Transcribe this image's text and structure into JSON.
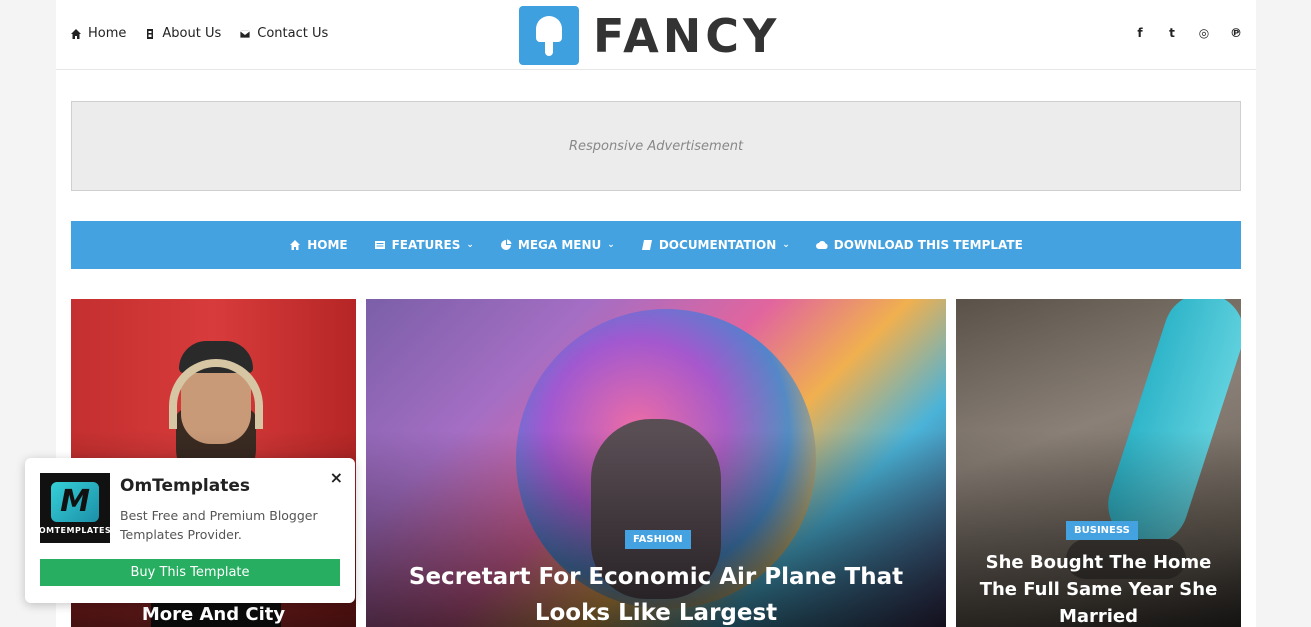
{
  "top_nav": {
    "items": [
      {
        "label": "Home",
        "icon": "home-icon"
      },
      {
        "label": "About Us",
        "icon": "id-card-icon"
      },
      {
        "label": "Contact Us",
        "icon": "envelope-icon"
      }
    ]
  },
  "logo": {
    "text": "FANCY",
    "accent": "#3fa0e0"
  },
  "social": [
    {
      "icon": "facebook-icon",
      "glyph": "f"
    },
    {
      "icon": "twitter-icon",
      "glyph": "t"
    },
    {
      "icon": "instagram-icon",
      "glyph": "◎"
    },
    {
      "icon": "pinterest-icon",
      "glyph": "℗"
    }
  ],
  "ad": {
    "text": "Responsive Advertisement"
  },
  "main_nav": {
    "items": [
      {
        "label": "HOME",
        "icon": "home-icon",
        "dropdown": false
      },
      {
        "label": "FEATURES",
        "icon": "list-icon",
        "dropdown": true
      },
      {
        "label": "MEGA MENU",
        "icon": "pie-chart-icon",
        "dropdown": true
      },
      {
        "label": "DOCUMENTATION",
        "icon": "book-icon",
        "dropdown": true
      },
      {
        "label": "DOWNLOAD THIS TEMPLATE",
        "icon": "cloud-download-icon",
        "dropdown": false
      }
    ],
    "chevron": "⌄",
    "color": "#45a2e0"
  },
  "featured": {
    "left": {
      "title": "More And City"
    },
    "center": {
      "badge": "FASHION",
      "title": "Secretart For Economic Air Plane That Looks Like Largest"
    },
    "right": {
      "badge": "BUSINESS",
      "title": "She Bought The Home The Full Same Year She Married"
    }
  },
  "popup": {
    "logo_letter": "M",
    "logo_text": "OMTEMPLATES",
    "title": "OmTemplates",
    "description": "Best Free and Premium Blogger Templates Provider.",
    "close": "×",
    "button": "Buy This Template",
    "button_color": "#27ae60"
  }
}
